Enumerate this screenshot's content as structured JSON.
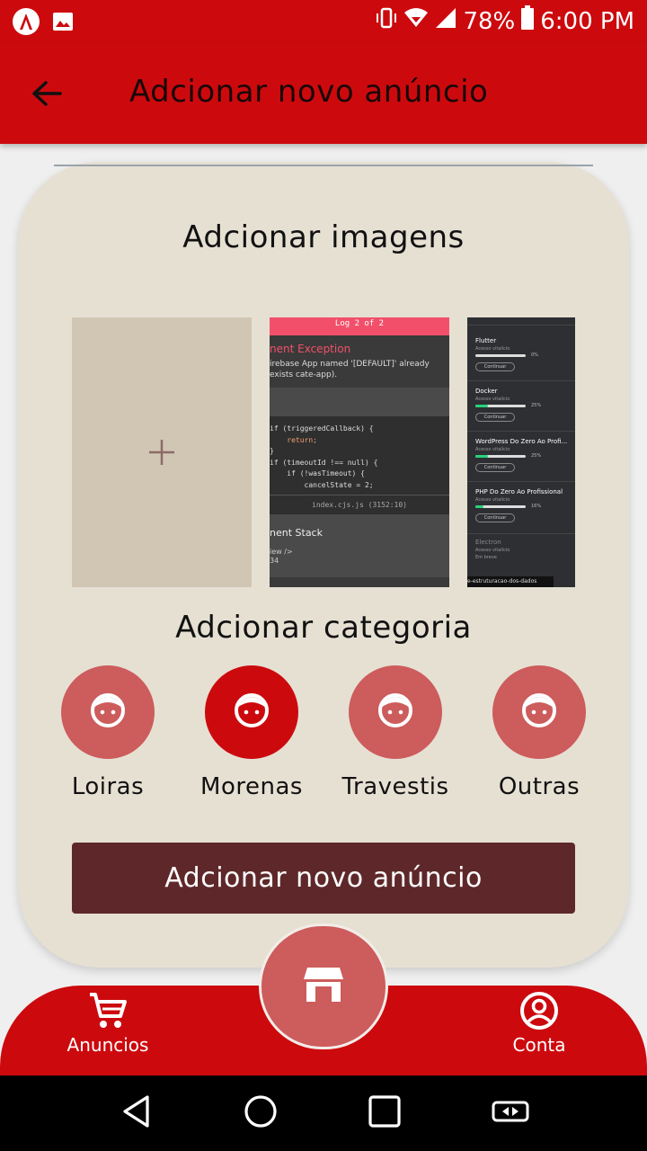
{
  "status_bar": {
    "battery": "78%",
    "time": "6:00 PM",
    "left_icons": [
      "app-logo-icon",
      "image-icon"
    ],
    "right_icons": [
      "vibrate-icon",
      "wifi-icon",
      "signal-icon",
      "battery-icon"
    ]
  },
  "app_bar": {
    "title": "Adcionar novo anúncio",
    "back_icon": "arrow-left-icon"
  },
  "images_section": {
    "title": "Adcionar imagens",
    "add_icon": "plus-icon",
    "thumb1": {
      "header": "Log 2 of 2",
      "exception": "nent Exception",
      "message": "irebase App named '[DEFAULT]' already exists cate-app).",
      "code_lines": [
        "if (triggeredCallback) {",
        "    return;",
        "}",
        "if (timeoutId !== null) {",
        "    if (!wasTimeout) {",
        "        cancelState = 2;"
      ],
      "file": "index.cjs.js (3152:10)",
      "stack_title": "nent Stack",
      "stack_sub1": "iew />",
      "stack_sub2": "34"
    },
    "thumb2": {
      "courses": [
        {
          "name": "Flutter",
          "sub": "Acesso vitalício",
          "pct": "0%",
          "progress": 0,
          "btn": "Continuar"
        },
        {
          "name": "Docker",
          "sub": "Acesso vitalício",
          "pct": "25%",
          "progress": 0.25,
          "btn": "Continuar"
        },
        {
          "name": "WordPress Do Zero Ao Profi...",
          "sub": "Acesso vitalício",
          "pct": "25%",
          "progress": 0.25,
          "btn": "Continuar"
        },
        {
          "name": "PHP Do Zero Ao Profissional",
          "sub": "Acesso vitalício",
          "pct": "16%",
          "progress": 0.16,
          "btn": "Continuar"
        }
      ],
      "electron": "Electron",
      "electron_sub1": "Acesso vitalício",
      "electron_sub2": "Em breve",
      "footer": "e-estruturacao-dos-dados"
    }
  },
  "category_section": {
    "title": "Adcionar categoria",
    "categories": [
      {
        "label": "Loiras",
        "icon": "face-icon",
        "selected": false
      },
      {
        "label": "Morenas",
        "icon": "face-icon",
        "selected": true
      },
      {
        "label": "Travestis",
        "icon": "face-icon",
        "selected": false
      },
      {
        "label": "Outras",
        "icon": "face-icon",
        "selected": false
      }
    ]
  },
  "submit_button": "Adcionar novo anúncio",
  "bottom_nav": {
    "left_label": "Anuncios",
    "left_icon": "cart-icon",
    "right_label": "Conta",
    "right_icon": "account-icon",
    "center_icon": "store-icon"
  },
  "system_nav": [
    "back-triangle-icon",
    "home-circle-icon",
    "recents-square-icon",
    "rotate-icon"
  ],
  "colors": {
    "primary": "#cc0a0e",
    "card_bg": "#e6e0d3",
    "category": "#cd5c5c",
    "button": "#5e282b"
  }
}
